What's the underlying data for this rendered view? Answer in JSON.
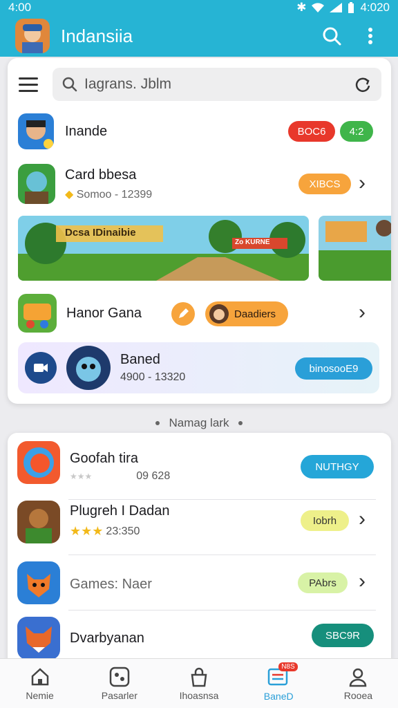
{
  "status_bar": {
    "time": "4:00",
    "right_time": "4:020"
  },
  "app_bar": {
    "title": "Indansiia"
  },
  "search": {
    "value": "Iagrans. Jblm"
  },
  "card1": {
    "row1": {
      "title": "Inande",
      "pill_red": "BOC6",
      "pill_green": "4:2"
    },
    "row2": {
      "title": "Card bbesa",
      "subtitle": "Somoo - 12399",
      "pill": "XIBCS"
    },
    "banner": {
      "title": "Dcsa IDinaibie",
      "sign": "Zo KURNE"
    },
    "row3": {
      "title": "Hanor Gana",
      "pill": "Daadiers"
    },
    "row4": {
      "title": "Baned",
      "subtitle": "4900 - 13320",
      "pill": "binosooE9"
    }
  },
  "section_label": "Namag lark",
  "list": [
    {
      "title": "Goofah tira",
      "subtitle": "09 628",
      "stars": 0,
      "button": "NUTHGY",
      "button_color": "#25a6d8"
    },
    {
      "title": "Plugreh I Dadan",
      "subtitle": "23:350",
      "stars": 3,
      "button": "Iobrh",
      "button_color": "#eef08a"
    },
    {
      "title": "Games: Naer",
      "subtitle": "",
      "stars": 0,
      "button": "PAbrs",
      "button_color": "#d8f2a6"
    },
    {
      "title": "Dvarbyanan",
      "subtitle": "",
      "stars": 0,
      "button": "SBC9R",
      "button_color": "#168f7c"
    }
  ],
  "nav": [
    {
      "label": "Nemie",
      "icon": "home-icon"
    },
    {
      "label": "Pasarler",
      "icon": "gamepad-icon"
    },
    {
      "label": "Ihoasnsa",
      "icon": "bag-icon"
    },
    {
      "label": "BaneD",
      "icon": "news-icon",
      "badge": "N8S",
      "active": true
    },
    {
      "label": "Rooea",
      "icon": "profile-icon"
    }
  ],
  "colors": {
    "primary": "#26b4d4",
    "red": "#e8382b",
    "green": "#3fb54a",
    "orange": "#f7a43c"
  }
}
